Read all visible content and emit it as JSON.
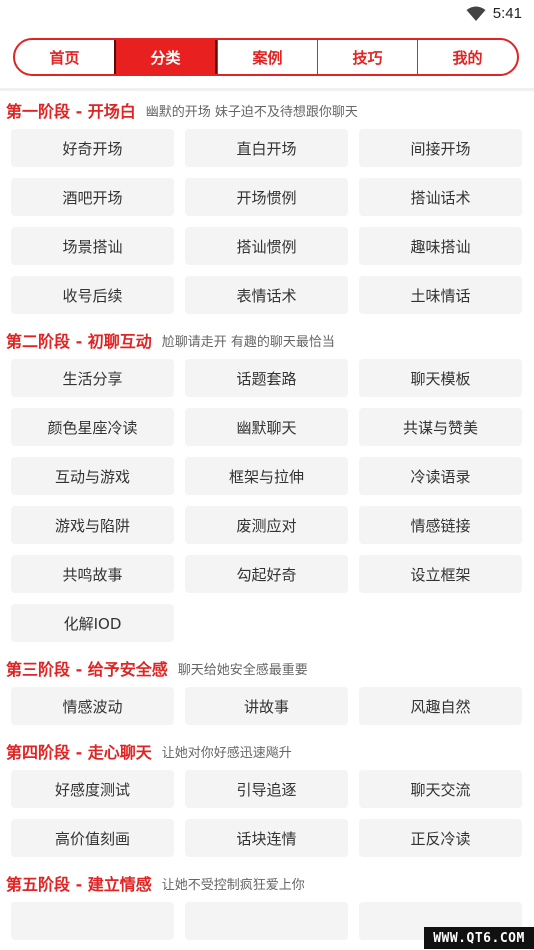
{
  "status_bar": {
    "time": "5:41",
    "icons": [
      "wifi-icon"
    ]
  },
  "tabs": [
    {
      "label": "首页",
      "active": false
    },
    {
      "label": "分类",
      "active": true
    },
    {
      "label": "案例",
      "active": false
    },
    {
      "label": "技巧",
      "active": false
    },
    {
      "label": "我的",
      "active": false
    }
  ],
  "sections": [
    {
      "title": "第一阶段 - 开场白",
      "desc": "幽默的开场 妹子迫不及待想跟你聊天",
      "items": [
        "好奇开场",
        "直白开场",
        "间接开场",
        "酒吧开场",
        "开场惯例",
        "搭讪话术",
        "场景搭讪",
        "搭讪惯例",
        "趣味搭讪",
        "收号后续",
        "表情话术",
        "土味情话"
      ]
    },
    {
      "title": "第二阶段 - 初聊互动",
      "desc": "尬聊请走开 有趣的聊天最恰当",
      "items": [
        "生活分享",
        "话题套路",
        "聊天模板",
        "颜色星座冷读",
        "幽默聊天",
        "共谋与赞美",
        "互动与游戏",
        "框架与拉伸",
        "冷读语录",
        "游戏与陷阱",
        "废测应对",
        "情感链接",
        "共鸣故事",
        "勾起好奇",
        "设立框架",
        "化解IOD"
      ]
    },
    {
      "title": "第三阶段 - 给予安全感",
      "desc": "聊天给她安全感最重要",
      "items": [
        "情感波动",
        "讲故事",
        "风趣自然"
      ]
    },
    {
      "title": "第四阶段 - 走心聊天",
      "desc": "让她对你好感迅速飚升",
      "items": [
        "好感度测试",
        "引导追逐",
        "聊天交流",
        "高价值刻画",
        "话块连情",
        "正反冷读"
      ]
    },
    {
      "title": "第五阶段 - 建立情感",
      "desc": "让她不受控制疯狂爱上你",
      "items": []
    }
  ],
  "watermark": "WWW.QT6.COM",
  "colors": {
    "accent": "#e02424",
    "item_bg": "#f4f4f4"
  }
}
